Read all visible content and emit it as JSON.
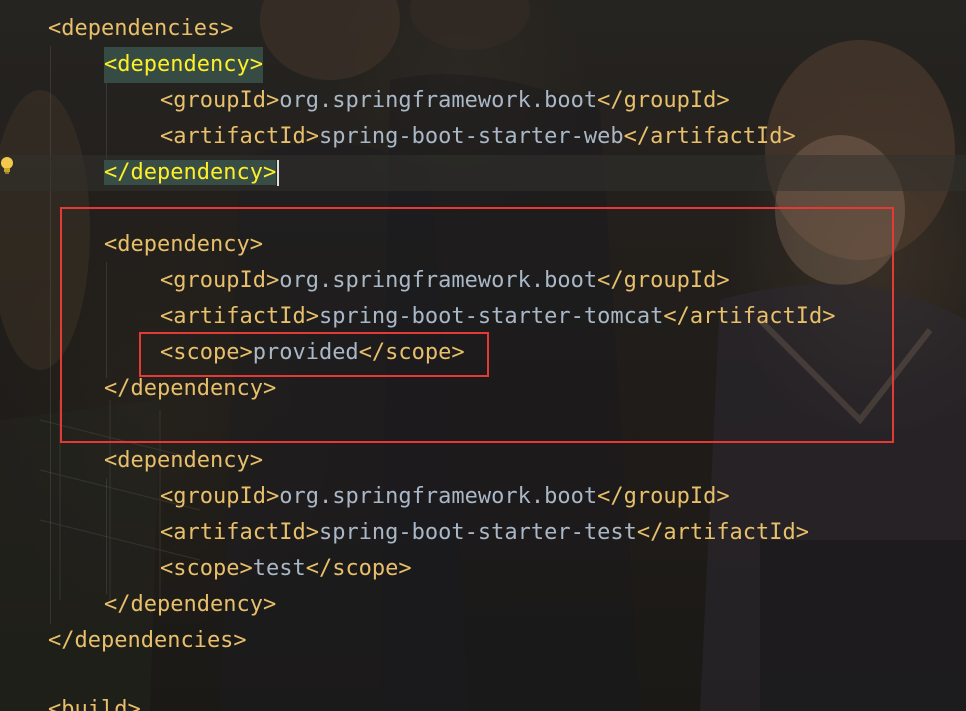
{
  "editor": {
    "lines": [
      {
        "tag_open": "<dependencies>",
        "text": "",
        "tag_close": ""
      },
      {
        "tag_open": "<dependency>",
        "text": "",
        "tag_close": ""
      },
      {
        "tag_open": "<groupId>",
        "text": "org.springframework.boot",
        "tag_close": "</groupId>"
      },
      {
        "tag_open": "<artifactId>",
        "text": "spring-boot-starter-web",
        "tag_close": "</artifactId>"
      },
      {
        "tag_open": "</dependency>",
        "text": "",
        "tag_close": ""
      },
      {
        "tag_open": "",
        "text": "",
        "tag_close": ""
      },
      {
        "tag_open": "<dependency>",
        "text": "",
        "tag_close": ""
      },
      {
        "tag_open": "<groupId>",
        "text": "org.springframework.boot",
        "tag_close": "</groupId>"
      },
      {
        "tag_open": "<artifactId>",
        "text": "spring-boot-starter-tomcat",
        "tag_close": "</artifactId>"
      },
      {
        "tag_open": "<scope>",
        "text": "provided",
        "tag_close": "</scope>"
      },
      {
        "tag_open": "</dependency>",
        "text": "",
        "tag_close": ""
      },
      {
        "tag_open": "",
        "text": "",
        "tag_close": ""
      },
      {
        "tag_open": "<dependency>",
        "text": "",
        "tag_close": ""
      },
      {
        "tag_open": "<groupId>",
        "text": "org.springframework.boot",
        "tag_close": "</groupId>"
      },
      {
        "tag_open": "<artifactId>",
        "text": "spring-boot-starter-test",
        "tag_close": "</artifactId>"
      },
      {
        "tag_open": "<scope>",
        "text": "test",
        "tag_close": "</scope>"
      },
      {
        "tag_open": "</dependency>",
        "text": "",
        "tag_close": ""
      },
      {
        "tag_open": "</dependencies>",
        "text": "",
        "tag_close": ""
      },
      {
        "tag_open": "",
        "text": "",
        "tag_close": ""
      },
      {
        "tag_open": "<build>",
        "text": "",
        "tag_close": ""
      }
    ]
  },
  "colors": {
    "tag": "#e8bf6a",
    "text": "#a9b7c6",
    "annotation_box": "#e53935",
    "matched_tag": "#ffef28"
  },
  "icons": {
    "gutter": "lightbulb-icon"
  }
}
